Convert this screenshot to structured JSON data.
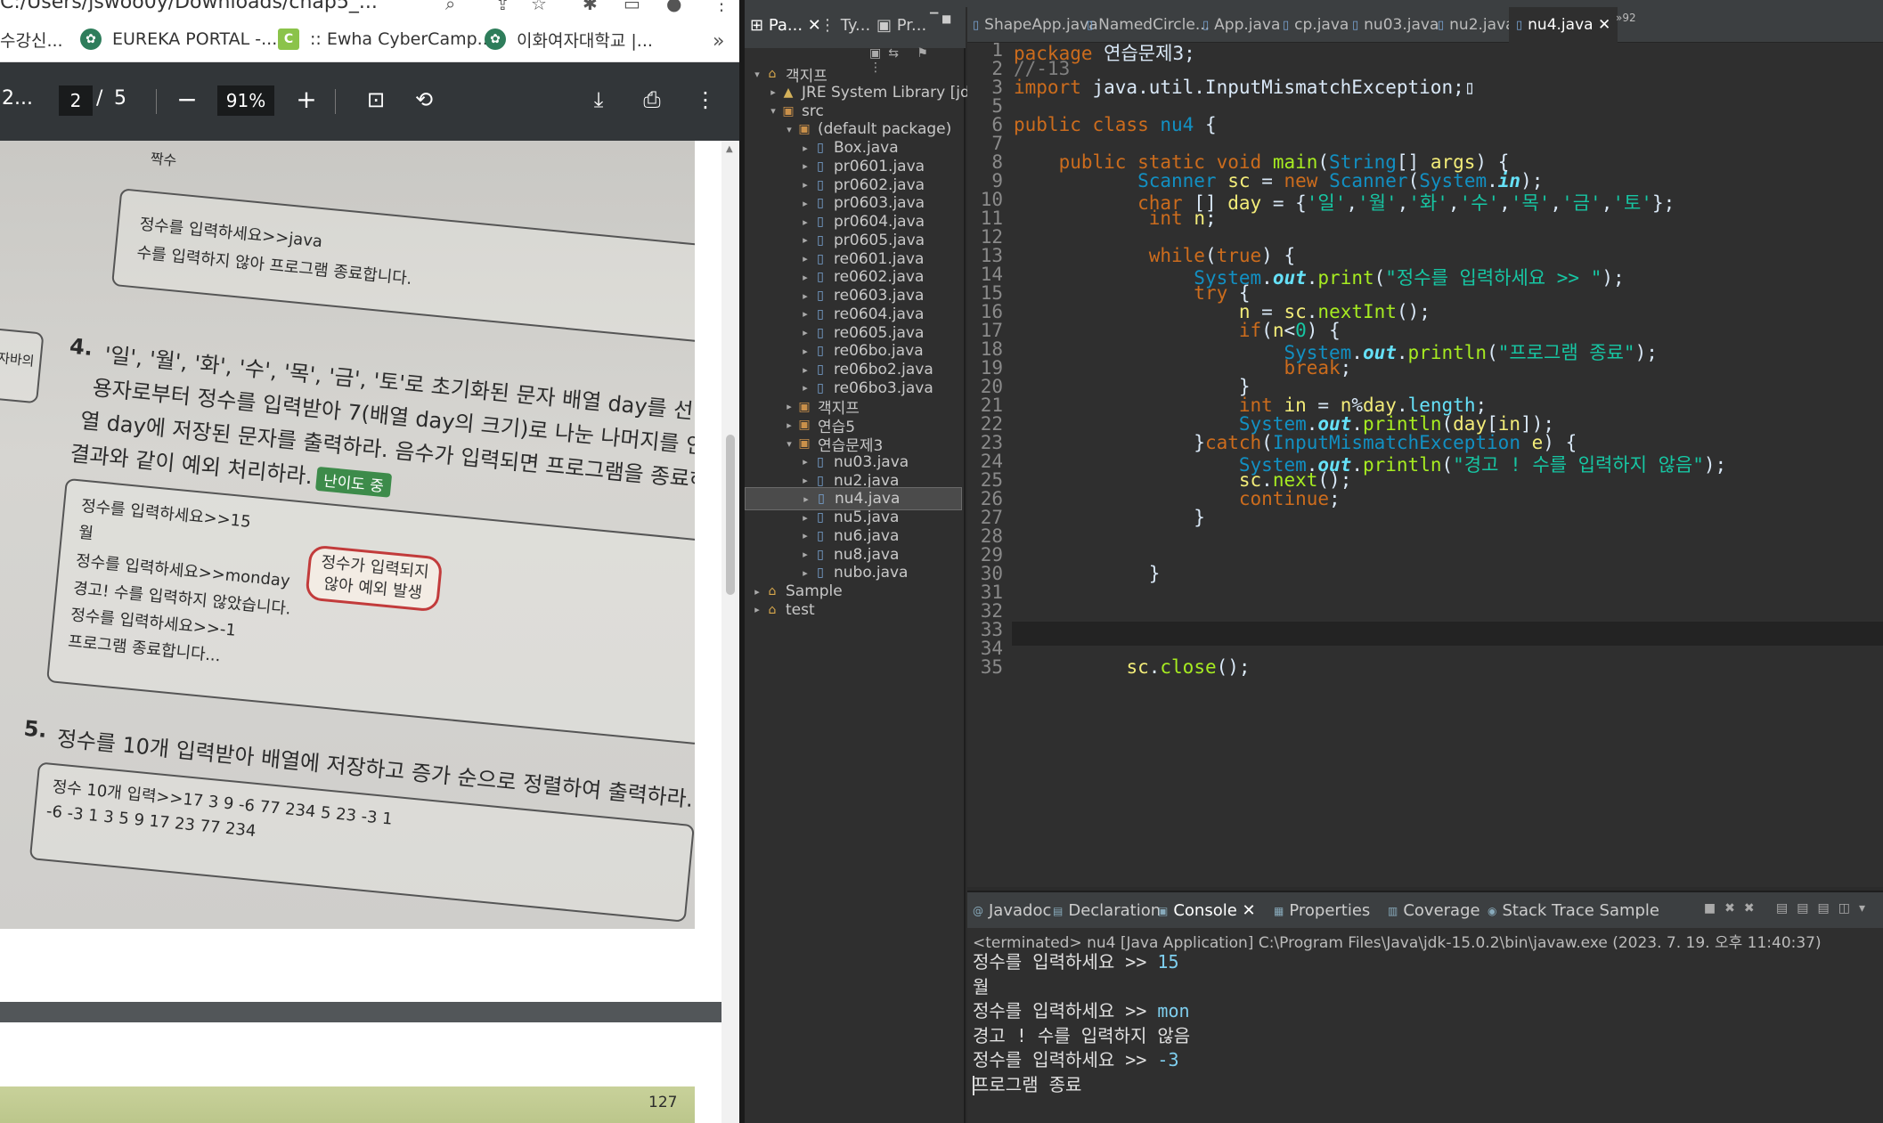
{
  "chrome": {
    "url_fragment": "C:/Users/jswoo0y/Downloads/chap5_..."
  },
  "bookmarks": [
    {
      "label": "수강신...",
      "icon": "none"
    },
    {
      "label": "EUREKA PORTAL -...",
      "icon": "ewha-logo"
    },
    {
      "label": ":: Ewha CyberCamp...",
      "icon": "cybercampus-c"
    },
    {
      "label": "이화여자대학교 |...",
      "icon": "ewha-logo"
    }
  ],
  "pdf": {
    "title": "2...",
    "page_current": "2",
    "page_sep": "/",
    "page_total": "5",
    "zoom": "91%",
    "page2_number": "127",
    "content": {
      "top_label": "짝수",
      "box1_line1": "정수를 입력하세요>>java",
      "box1_line2": "수를 입력하지 않아 프로그램 종료합니다.",
      "side_label": "작 자바의",
      "q4_num": "4.",
      "q4_line1": "'일', '월', '화', '수', '목', '금', '토'로 초기화된 문자 배열 day를 선언",
      "q4_line2": "용자로부터 정수를 입력받아 7(배열 day의 크기)로 나눈 나머지를 인덱스로",
      "q4_line3": "열 day에 저장된 문자를 출력하라. 음수가 입력되면 프로그램을 종료하라. 예",
      "q4_line4": "결과와 같이 예외 처리하라.",
      "difficulty": "난이도 중",
      "ex_line1": "정수를 입력하세요>>15",
      "ex_line2": "월",
      "ex_line3": "정수를 입력하세요>>monday",
      "ex_line4": "경고! 수를 입력하지 않았습니다.",
      "ex_line5": "정수를 입력하세요>>-1",
      "ex_line6": "프로그램 종료합니다...",
      "bubble": "정수가 입력되지 않아 예외 발생",
      "q5_num": "5.",
      "q5_text": "정수를 10개 입력받아 배열에 저장하고 증가 순으로 정렬하여 출력하라.",
      "q5_ex1": "정수 10개 입력>>17 3 9 -6 77 234 5 23 -3 1",
      "q5_ex2": "-6 -3 1 3 5 9 17 23 77 234"
    }
  },
  "eclipse": {
    "pkg_tabs": [
      "Pa...",
      "Ty...",
      "Pr..."
    ],
    "tree": [
      {
        "label": "객지프",
        "indent": 0,
        "twisty": "▾",
        "icon": "proj"
      },
      {
        "label": "JRE System Library [jd",
        "indent": 1,
        "twisty": "▸",
        "icon": "lib"
      },
      {
        "label": "src",
        "indent": 1,
        "twisty": "▾",
        "icon": "pkg"
      },
      {
        "label": "(default package)",
        "indent": 2,
        "twisty": "▾",
        "icon": "pkg"
      },
      {
        "label": "Box.java",
        "indent": 3,
        "twisty": "▸",
        "icon": "file"
      },
      {
        "label": "pr0601.java",
        "indent": 3,
        "twisty": "▸",
        "icon": "file"
      },
      {
        "label": "pr0602.java",
        "indent": 3,
        "twisty": "▸",
        "icon": "file"
      },
      {
        "label": "pr0603.java",
        "indent": 3,
        "twisty": "▸",
        "icon": "file"
      },
      {
        "label": "pr0604.java",
        "indent": 3,
        "twisty": "▸",
        "icon": "file"
      },
      {
        "label": "pr0605.java",
        "indent": 3,
        "twisty": "▸",
        "icon": "file"
      },
      {
        "label": "re0601.java",
        "indent": 3,
        "twisty": "▸",
        "icon": "file"
      },
      {
        "label": "re0602.java",
        "indent": 3,
        "twisty": "▸",
        "icon": "file"
      },
      {
        "label": "re0603.java",
        "indent": 3,
        "twisty": "▸",
        "icon": "file"
      },
      {
        "label": "re0604.java",
        "indent": 3,
        "twisty": "▸",
        "icon": "file"
      },
      {
        "label": "re0605.java",
        "indent": 3,
        "twisty": "▸",
        "icon": "file"
      },
      {
        "label": "re06bo.java",
        "indent": 3,
        "twisty": "▸",
        "icon": "file"
      },
      {
        "label": "re06bo2.java",
        "indent": 3,
        "twisty": "▸",
        "icon": "file"
      },
      {
        "label": "re06bo3.java",
        "indent": 3,
        "twisty": "▸",
        "icon": "file"
      },
      {
        "label": "객지프",
        "indent": 2,
        "twisty": "▸",
        "icon": "pkg"
      },
      {
        "label": "연습5",
        "indent": 2,
        "twisty": "▸",
        "icon": "pkg"
      },
      {
        "label": "연습문제3",
        "indent": 2,
        "twisty": "▾",
        "icon": "pkg"
      },
      {
        "label": "nu03.java",
        "indent": 3,
        "twisty": "▸",
        "icon": "file"
      },
      {
        "label": "nu2.java",
        "indent": 3,
        "twisty": "▸",
        "icon": "file"
      },
      {
        "label": "nu4.java",
        "indent": 3,
        "twisty": "▸",
        "icon": "file",
        "selected": true
      },
      {
        "label": "nu5.java",
        "indent": 3,
        "twisty": "▸",
        "icon": "file"
      },
      {
        "label": "nu6.java",
        "indent": 3,
        "twisty": "▸",
        "icon": "file"
      },
      {
        "label": "nu8.java",
        "indent": 3,
        "twisty": "▸",
        "icon": "file"
      },
      {
        "label": "nubo.java",
        "indent": 3,
        "twisty": "▸",
        "icon": "file"
      },
      {
        "label": "Sample",
        "indent": 0,
        "twisty": "▸",
        "icon": "proj"
      },
      {
        "label": "test",
        "indent": 0,
        "twisty": "▸",
        "icon": "proj"
      }
    ],
    "editor_tabs": [
      {
        "label": "ShapeApp.java"
      },
      {
        "label": "NamedCircle..."
      },
      {
        "label": "App.java"
      },
      {
        "label": "cp.java"
      },
      {
        "label": "nu03.java"
      },
      {
        "label": "nu2.java"
      },
      {
        "label": "nu4.java",
        "active": true
      }
    ],
    "editor_overflow": "»92",
    "code_lines": [
      "1",
      "2",
      "3",
      "5",
      "6",
      "7",
      "8",
      "9",
      "10",
      "11",
      "12",
      "13",
      "14",
      "15",
      "16",
      "17",
      "18",
      "19",
      "20",
      "21",
      "22",
      "23",
      "24",
      "25",
      "26",
      "27",
      "28",
      "29",
      "30",
      "31",
      "32",
      "33",
      "34",
      "35"
    ],
    "console_tabs": [
      {
        "label": "Javadoc"
      },
      {
        "label": "Declaration"
      },
      {
        "label": "Console",
        "active": true
      },
      {
        "label": "Properties"
      },
      {
        "label": "Coverage"
      },
      {
        "label": "Stack Trace Sample"
      }
    ],
    "console_header": "<terminated> nu4 [Java Application] C:\\Program Files\\Java\\jdk-15.0.2\\bin\\javaw.exe (2023. 7. 19. 오후 11:40:37)",
    "console_lines": [
      {
        "out": "정수를 입력하세요 >> ",
        "in": "15"
      },
      {
        "out": "월",
        "in": ""
      },
      {
        "out": "정수를 입력하세요 >> ",
        "in": "mon"
      },
      {
        "out": "경고 ! 수를 입력하지 않음",
        "in": ""
      },
      {
        "out": "정수를 입력하세요 >> ",
        "in": "-3"
      },
      {
        "out": "프로그램 종료",
        "in": ""
      }
    ]
  }
}
